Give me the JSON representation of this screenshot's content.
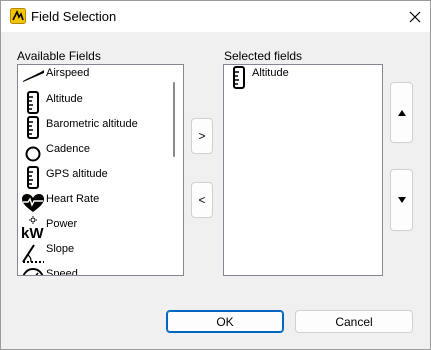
{
  "window": {
    "title": "Field Selection"
  },
  "available": {
    "label": "Available Fields",
    "items": [
      {
        "label": "Airspeed",
        "icon": "airspeed-icon"
      },
      {
        "label": "Altitude",
        "icon": "ruler-icon"
      },
      {
        "label": "Barometric altitude",
        "icon": "ruler-icon"
      },
      {
        "label": "Cadence",
        "icon": "cadence-icon"
      },
      {
        "label": "GPS altitude",
        "icon": "ruler-icon"
      },
      {
        "label": "Heart Rate",
        "icon": "heart-rate-icon"
      },
      {
        "label": "Power",
        "icon": "power-icon"
      },
      {
        "label": "Slope",
        "icon": "slope-icon"
      },
      {
        "label": "Speed",
        "icon": "speed-icon"
      }
    ]
  },
  "selected": {
    "label": "Selected fields",
    "items": [
      {
        "label": "Altitude",
        "icon": "ruler-icon"
      }
    ]
  },
  "buttons": {
    "add": ">",
    "remove": "<",
    "ok": "OK",
    "cancel": "Cancel"
  },
  "colors": {
    "accent": "#0067c0",
    "app_icon_bg": "#f5c400"
  }
}
